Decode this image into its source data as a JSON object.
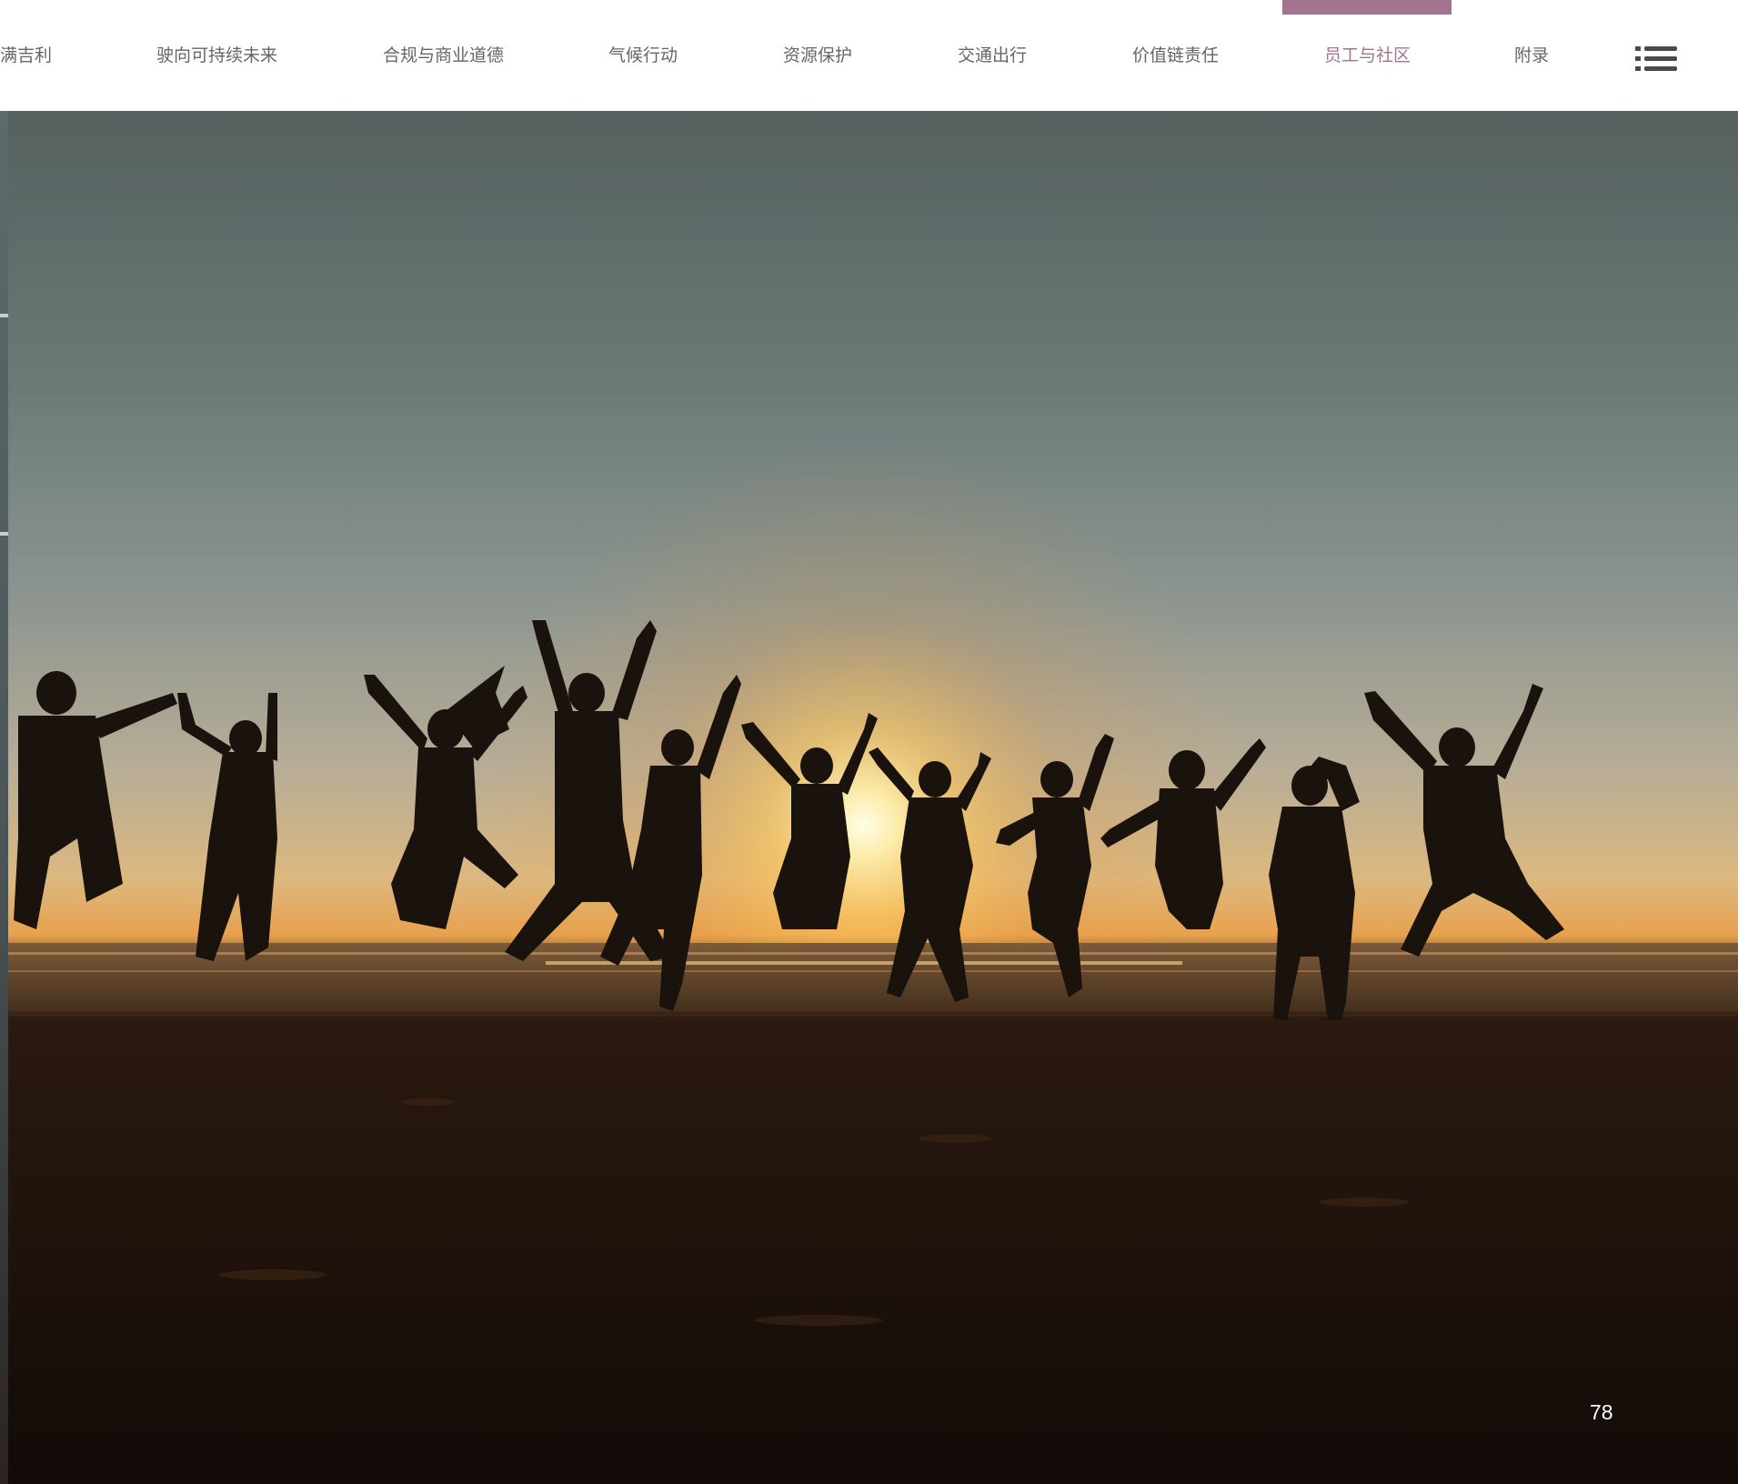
{
  "nav": {
    "items": [
      {
        "label": "满吉利"
      },
      {
        "label": "驶向可持续未来"
      },
      {
        "label": "合规与商业道德"
      },
      {
        "label": "气候行动"
      },
      {
        "label": "资源保护"
      },
      {
        "label": "交通出行"
      },
      {
        "label": "价值链责任"
      },
      {
        "label": "员工与社区"
      },
      {
        "label": "附录"
      }
    ],
    "active_index": 7,
    "menu_icon": "hamburger-list-icon"
  },
  "hero": {
    "image": "silhouettes-jumping-at-beach-sunset"
  },
  "page_number": "78",
  "colors": {
    "accent": "#a3738f",
    "nav_text": "#666666",
    "background": "#ffffff"
  }
}
